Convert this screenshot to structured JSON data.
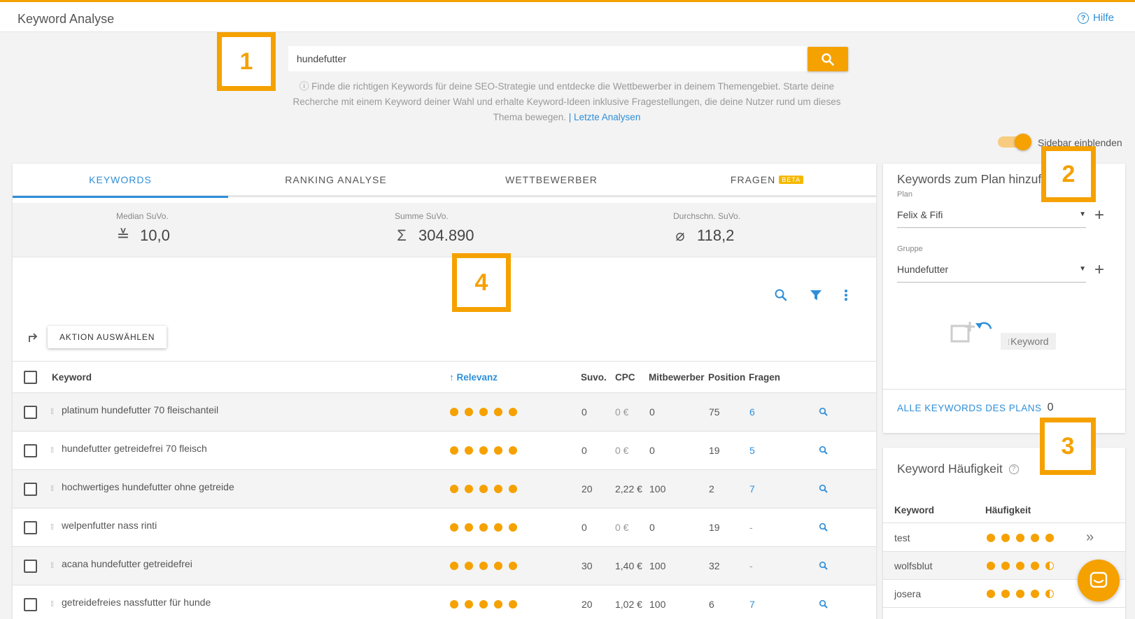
{
  "header": {
    "title": "Keyword Analyse",
    "help_label": "Hilfe"
  },
  "markers": {
    "m1": "1",
    "m2": "2",
    "m3": "3",
    "m4": "4"
  },
  "search": {
    "value": "hundefutter",
    "info_text": "ⓘ Finde die richtigen Keywords für deine SEO-Strategie und entdecke die Wettbewerber in deinem Themengebiet. Starte deine Recherche mit einem Keyword deiner Wahl und erhalte Keyword-Ideen inklusive Fragestellungen, die deine Nutzer rund um dieses Thema bewegen.",
    "last_analyses_link": "| Letzte Analysen"
  },
  "sidebar_toggle": {
    "label": "Sidebar einblenden",
    "on": true
  },
  "tabs": [
    {
      "label": "KEYWORDS",
      "active": true
    },
    {
      "label": "RANKING ANALYSE",
      "active": false
    },
    {
      "label": "WETTBEWERBER",
      "active": false
    },
    {
      "label": "FRAGEN",
      "active": false,
      "badge": "BETA"
    }
  ],
  "stats": {
    "median": {
      "label": "Median SuVo.",
      "symbol": "≚",
      "value": "10,0"
    },
    "sum": {
      "label": "Summe SuVo.",
      "symbol": "Σ",
      "value": "304.890"
    },
    "avg": {
      "label": "Durchschn. SuVo.",
      "symbol": "⌀",
      "value": "118,2"
    }
  },
  "action_button": "AKTION AUSWÄHLEN",
  "table": {
    "headers": {
      "keyword": "Keyword",
      "relevance": "↑ Relevanz",
      "suvo": "Suvo.",
      "cpc": "CPC",
      "competitors": "Mitbewerber",
      "position": "Position",
      "questions": "Fragen"
    },
    "rows": [
      {
        "keyword": "platinum hundefutter 70 fleischanteil",
        "relevance": 5,
        "suvo": "0",
        "cpc": "0 €",
        "competitors": "0",
        "position": "75",
        "questions": "6"
      },
      {
        "keyword": "hundefutter getreidefrei 70 fleisch",
        "relevance": 5,
        "suvo": "0",
        "cpc": "0 €",
        "competitors": "0",
        "position": "19",
        "questions": "5"
      },
      {
        "keyword": "hochwertiges hundefutter ohne getreide",
        "relevance": 5,
        "suvo": "20",
        "cpc": "2,22 €",
        "competitors": "100",
        "position": "2",
        "questions": "7"
      },
      {
        "keyword": "welpenfutter nass rinti",
        "relevance": 5,
        "suvo": "0",
        "cpc": "0 €",
        "competitors": "0",
        "position": "19",
        "questions": "-"
      },
      {
        "keyword": "acana hundefutter getreidefrei",
        "relevance": 5,
        "suvo": "30",
        "cpc": "1,40 €",
        "competitors": "100",
        "position": "32",
        "questions": "-"
      },
      {
        "keyword": "getreidefreies nassfutter für hunde",
        "relevance": 5,
        "suvo": "20",
        "cpc": "1,02 €",
        "competitors": "100",
        "position": "6",
        "questions": "7"
      }
    ]
  },
  "plan_panel": {
    "title": "Keywords zum Plan hinzufügen",
    "plan_label": "Plan",
    "plan_value": "Felix & Fifi",
    "group_label": "Gruppe",
    "group_value": "Hundefutter",
    "keyword_chip": "Keyword",
    "all_keywords_label": "ALLE KEYWORDS DES PLANS",
    "all_keywords_count": "0"
  },
  "freq_panel": {
    "title": "Keyword Häufigkeit",
    "col_keyword": "Keyword",
    "col_freq": "Häufigkeit",
    "rows": [
      {
        "keyword": "test",
        "level": 5
      },
      {
        "keyword": "wolfsblut",
        "level": 4.5
      },
      {
        "keyword": "josera",
        "level": 4.5
      }
    ]
  },
  "colors": {
    "accent": "#f5a100",
    "link": "#2f8fd8"
  }
}
